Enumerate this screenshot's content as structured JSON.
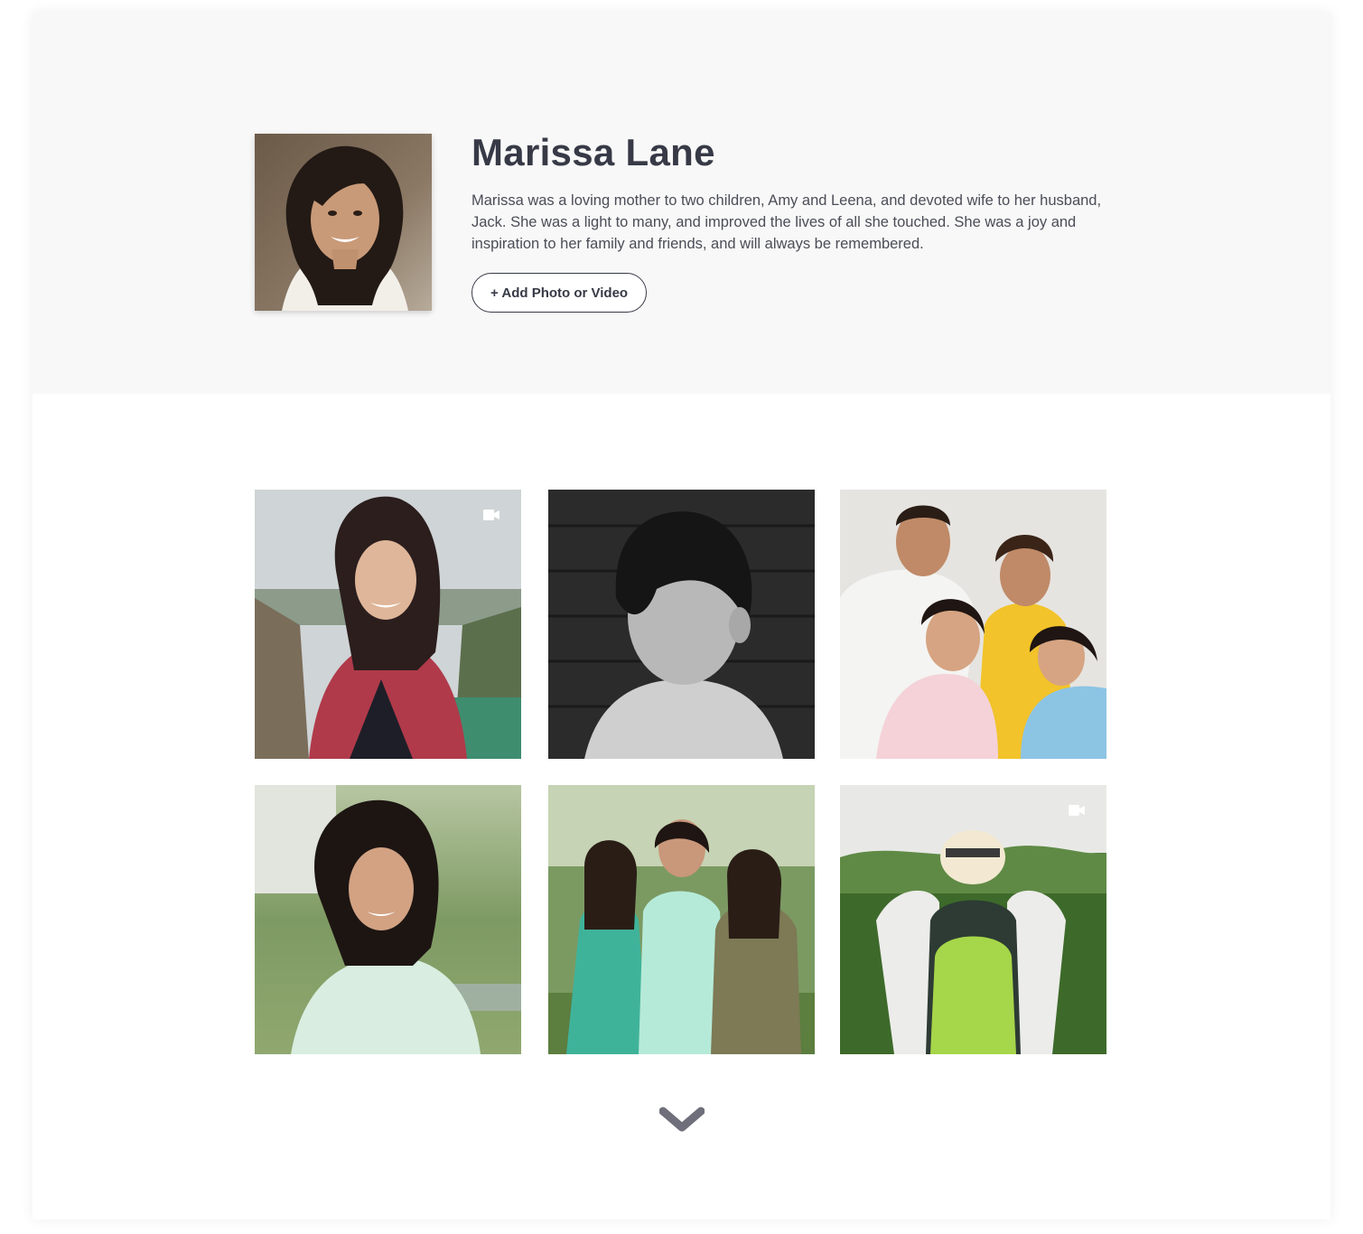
{
  "profile": {
    "name": "Marissa Lane",
    "bio": "Marissa was a loving mother to two children, Amy and Leena, and devoted wife to her husband, Jack. She was a light to many, and improved the lives of all she touched. She was a joy and inspiration to her family and friends, and will always be remembered.",
    "add_button_label": "+ Add Photo or Video"
  },
  "gallery": {
    "items": [
      {
        "type": "video",
        "icon": "video-camera-icon",
        "scene": "woman-cliff-plaid-shirt"
      },
      {
        "type": "photo",
        "scene": "child-black-and-white"
      },
      {
        "type": "photo",
        "scene": "family-of-four"
      },
      {
        "type": "photo",
        "scene": "woman-park-portrait"
      },
      {
        "type": "photo",
        "scene": "three-women-outdoors"
      },
      {
        "type": "video",
        "icon": "video-camera-icon",
        "scene": "hiker-backpack-forest"
      }
    ]
  },
  "load_more_icon": "chevron-down-icon",
  "colors": {
    "hero_background": "#f8f8f8",
    "text_dark": "#373a46",
    "text_body": "#4b4d57",
    "chevron": "#6e6f7a"
  }
}
